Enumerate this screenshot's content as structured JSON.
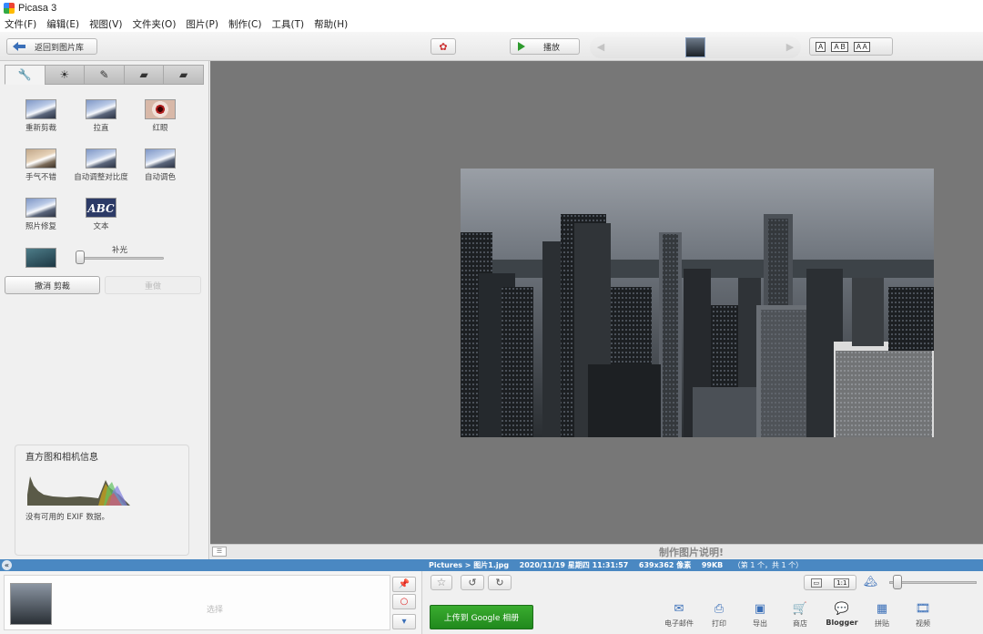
{
  "window": {
    "title": "Picasa 3"
  },
  "menu": [
    "文件(F)",
    "编辑(E)",
    "视图(V)",
    "文件夹(O)",
    "图片(P)",
    "制作(C)",
    "工具(T)",
    "帮助(H)"
  ],
  "toolbar": {
    "back_label": "返回到图片库",
    "play_label": "播放",
    "view_options": [
      "A",
      "A B",
      "A A"
    ]
  },
  "edit_panel": {
    "tab_icons": [
      "wrench-icon",
      "sun-icon",
      "brush-icon",
      "effects-icon",
      "effects2-icon"
    ],
    "tools": [
      {
        "label": "重新剪裁",
        "icon": "crop-icon"
      },
      {
        "label": "拉直",
        "icon": "straighten-icon"
      },
      {
        "label": "红眼",
        "icon": "redeye-icon"
      },
      {
        "label": "手气不错",
        "icon": "lucky-icon"
      },
      {
        "label": "自动调整对比度",
        "icon": "contrast-icon"
      },
      {
        "label": "自动调色",
        "icon": "color-icon"
      },
      {
        "label": "照片修复",
        "icon": "retouch-icon"
      },
      {
        "label": "文本",
        "icon": "text-icon",
        "thumb_text": "ABC"
      }
    ],
    "fill_light_label": "补光",
    "fill_light_value": 0,
    "undo_label": "撤消 剪裁",
    "redo_label": "重做"
  },
  "histogram": {
    "title": "直方图和相机信息",
    "exif_text": "没有可用的 EXIF 数据。"
  },
  "caption": {
    "text": "制作图片说明!"
  },
  "status": {
    "path": "Pictures > 图片1.jpg",
    "date": "2020/11/19 星期四 11:31:57",
    "size": "639x362 像素",
    "filesize": "99KB",
    "count": "（第 1 个，共 1 个）"
  },
  "tray": {
    "select_label": "选择"
  },
  "actions": {
    "upload_label": "上传到 Google 相册",
    "items": [
      {
        "label": "电子邮件",
        "icon": "email-icon"
      },
      {
        "label": "打印",
        "icon": "print-icon"
      },
      {
        "label": "导出",
        "icon": "export-icon"
      },
      {
        "label": "商店",
        "icon": "shop-icon"
      },
      {
        "label": "Blogger",
        "icon": "blogger-icon"
      },
      {
        "label": "拼贴",
        "icon": "collage-icon"
      },
      {
        "label": "视频",
        "icon": "video-icon"
      }
    ]
  },
  "zoom": {
    "level": 0.05
  },
  "colors": {
    "accent": "#4a88c2",
    "upload_green": "#2a9a25",
    "canvas": "#777777"
  }
}
